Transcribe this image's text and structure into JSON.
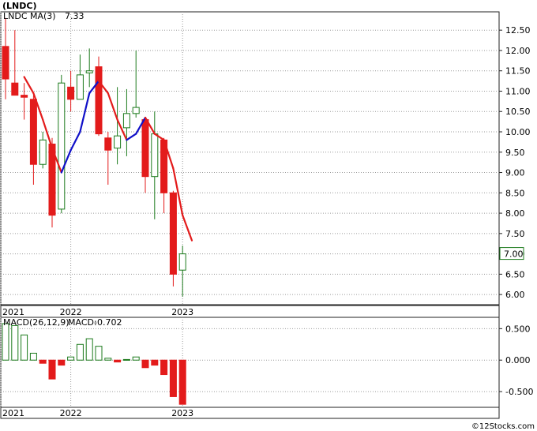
{
  "title": "(LNDC)",
  "watermark": "©12Stocks.com",
  "colors": {
    "up": "#1c7a1c",
    "down": "#e31b1b",
    "ma_up": "#1010c8",
    "ma_down": "#e31b1b",
    "date_band": "#a9d6e5",
    "tag_border": "#1c7a1c"
  },
  "chart_data": [
    {
      "type": "candlestick",
      "legend": {
        "ticker": "LNDC",
        "ma_label": "MA(3)",
        "ma_value": "7.33"
      },
      "last_price_tag": "7.00",
      "ylim": [
        5.75,
        12.95
      ],
      "y_ticks": [
        {
          "v": 6.0,
          "t": "6.00"
        },
        {
          "v": 6.5,
          "t": "6.50"
        },
        {
          "v": 7.0,
          "t": "7.00"
        },
        {
          "v": 7.5,
          "t": "7.50"
        },
        {
          "v": 8.0,
          "t": "8.00"
        },
        {
          "v": 8.5,
          "t": "8.50"
        },
        {
          "v": 9.0,
          "t": "9.00"
        },
        {
          "v": 9.5,
          "t": "9.50"
        },
        {
          "v": 10.0,
          "t": "10.00"
        },
        {
          "v": 10.5,
          "t": "10.50"
        },
        {
          "v": 11.0,
          "t": "11.00"
        },
        {
          "v": 11.5,
          "t": "11.50"
        },
        {
          "v": 12.0,
          "t": "12.00"
        },
        {
          "v": 12.5,
          "t": "12.50"
        }
      ],
      "x_labels": [
        {
          "i": 0,
          "t": "2021"
        },
        {
          "i": 7,
          "t": "2022"
        },
        {
          "i": 19,
          "t": "2023"
        }
      ],
      "candles": [
        {
          "o": 12.1,
          "h": 12.8,
          "l": 10.8,
          "c": 11.3
        },
        {
          "o": 11.2,
          "h": 12.5,
          "l": 11.0,
          "c": 10.9
        },
        {
          "o": 10.9,
          "h": 11.2,
          "l": 10.3,
          "c": 10.85
        },
        {
          "o": 10.8,
          "h": 10.9,
          "l": 8.7,
          "c": 9.2
        },
        {
          "o": 9.2,
          "h": 10.0,
          "l": 9.1,
          "c": 9.8
        },
        {
          "o": 9.7,
          "h": 9.85,
          "l": 7.65,
          "c": 7.95
        },
        {
          "o": 8.1,
          "h": 11.4,
          "l": 8.0,
          "c": 11.2
        },
        {
          "o": 11.1,
          "h": 11.5,
          "l": 10.5,
          "c": 10.8
        },
        {
          "o": 10.8,
          "h": 11.9,
          "l": 10.8,
          "c": 11.4
        },
        {
          "o": 11.45,
          "h": 12.05,
          "l": 11.1,
          "c": 11.5
        },
        {
          "o": 11.6,
          "h": 11.85,
          "l": 9.9,
          "c": 9.95
        },
        {
          "o": 9.85,
          "h": 10.0,
          "l": 8.7,
          "c": 9.55
        },
        {
          "o": 9.6,
          "h": 11.1,
          "l": 9.2,
          "c": 9.9
        },
        {
          "o": 10.1,
          "h": 11.05,
          "l": 9.4,
          "c": 10.45
        },
        {
          "o": 10.45,
          "h": 12.0,
          "l": 10.35,
          "c": 10.6
        },
        {
          "o": 10.3,
          "h": 10.35,
          "l": 8.5,
          "c": 8.9
        },
        {
          "o": 8.9,
          "h": 10.5,
          "l": 7.85,
          "c": 9.95
        },
        {
          "o": 9.8,
          "h": 9.85,
          "l": 8.0,
          "c": 8.5
        },
        {
          "o": 8.5,
          "h": 8.55,
          "l": 6.2,
          "c": 6.5
        },
        {
          "o": 6.6,
          "h": 7.2,
          "l": 5.95,
          "c": 7.0
        }
      ],
      "ma": {
        "start_index": 2,
        "values": [
          11.35,
          10.95,
          10.3,
          9.6,
          9.0,
          9.55,
          10.0,
          10.95,
          11.25,
          10.95,
          10.3,
          9.8,
          9.95,
          10.35,
          9.95,
          9.8,
          9.1,
          7.95,
          7.33
        ]
      }
    },
    {
      "type": "bar",
      "legend": {
        "macd_label": "MACD(26,12,9)",
        "value_label": "MACD:",
        "value": "-0.702"
      },
      "ylim": [
        -0.75,
        0.68
      ],
      "y_ticks": [
        {
          "v": 0.5,
          "t": "0.500"
        },
        {
          "v": 0.0,
          "t": "0.000"
        },
        {
          "v": -0.5,
          "t": "-0.500"
        }
      ],
      "x_labels": [
        {
          "i": 0,
          "t": "2021"
        },
        {
          "i": 7,
          "t": "2022"
        },
        {
          "i": 19,
          "t": "2023"
        }
      ],
      "values": [
        0.58,
        0.55,
        0.4,
        0.11,
        -0.05,
        -0.3,
        -0.08,
        0.05,
        0.25,
        0.34,
        0.22,
        0.03,
        -0.03,
        0.01,
        0.05,
        -0.12,
        -0.08,
        -0.23,
        -0.58,
        -0.702
      ]
    }
  ]
}
